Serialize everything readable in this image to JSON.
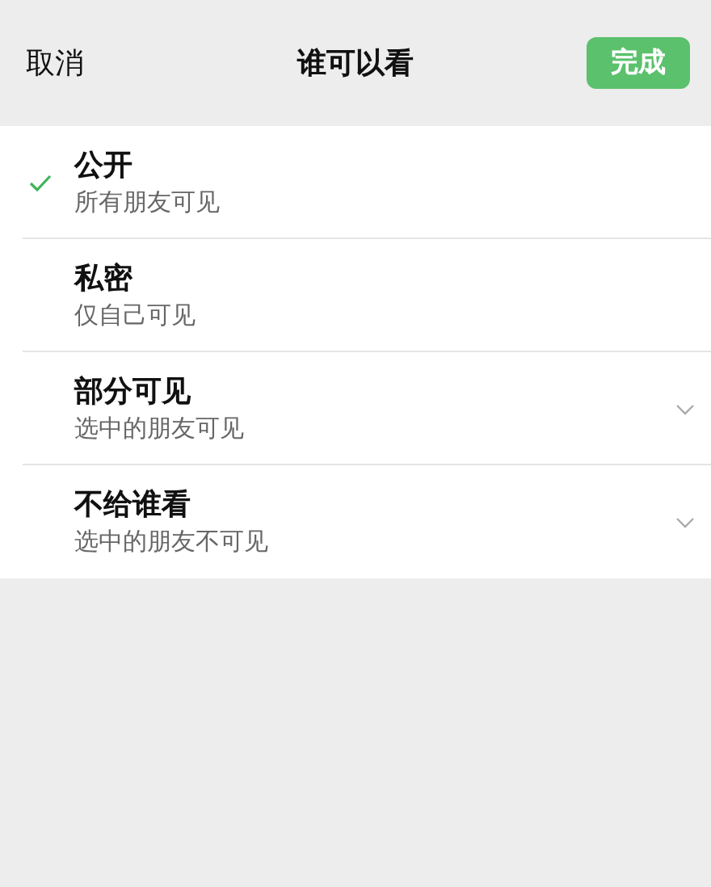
{
  "header": {
    "cancel": "取消",
    "title": "谁可以看",
    "done": "完成"
  },
  "options": [
    {
      "title": "公开",
      "subtitle": "所有朋友可见",
      "selected": true,
      "kind": "plain"
    },
    {
      "title": "私密",
      "subtitle": "仅自己可见",
      "selected": false,
      "kind": "plain"
    },
    {
      "title": "部分可见",
      "subtitle": "选中的朋友可见",
      "selected": false,
      "kind": "expandable"
    },
    {
      "title": "不给谁看",
      "subtitle": "选中的朋友不可见",
      "selected": false,
      "kind": "expandable"
    }
  ]
}
